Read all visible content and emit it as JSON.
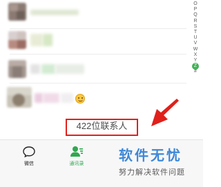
{
  "index_bar": {
    "letters": [
      "O",
      "P",
      "Q",
      "R",
      "S",
      "T",
      "U",
      "V",
      "W",
      "X",
      "Y",
      "Z",
      "#"
    ],
    "active": "Z",
    "active_color": "#3fb354"
  },
  "contact_list": {
    "note": "",
    "emoji_icon": "smiley-emoji"
  },
  "footer": {
    "contact_count_text": "422位联系人",
    "highlight_color": "#e0201b",
    "arrow_icon": "red-arrow-icon"
  },
  "tab_bar": {
    "tabs": [
      {
        "label": "微信",
        "icon": "chat-bubble-icon",
        "active": false
      },
      {
        "label": "通讯录",
        "icon": "contacts-icon",
        "active": true
      }
    ],
    "active_color": "#2fa84f"
  },
  "watermark": {
    "title": "软件无忧",
    "subtitle": "努力解决软件问题",
    "color": "#3e88d8"
  }
}
